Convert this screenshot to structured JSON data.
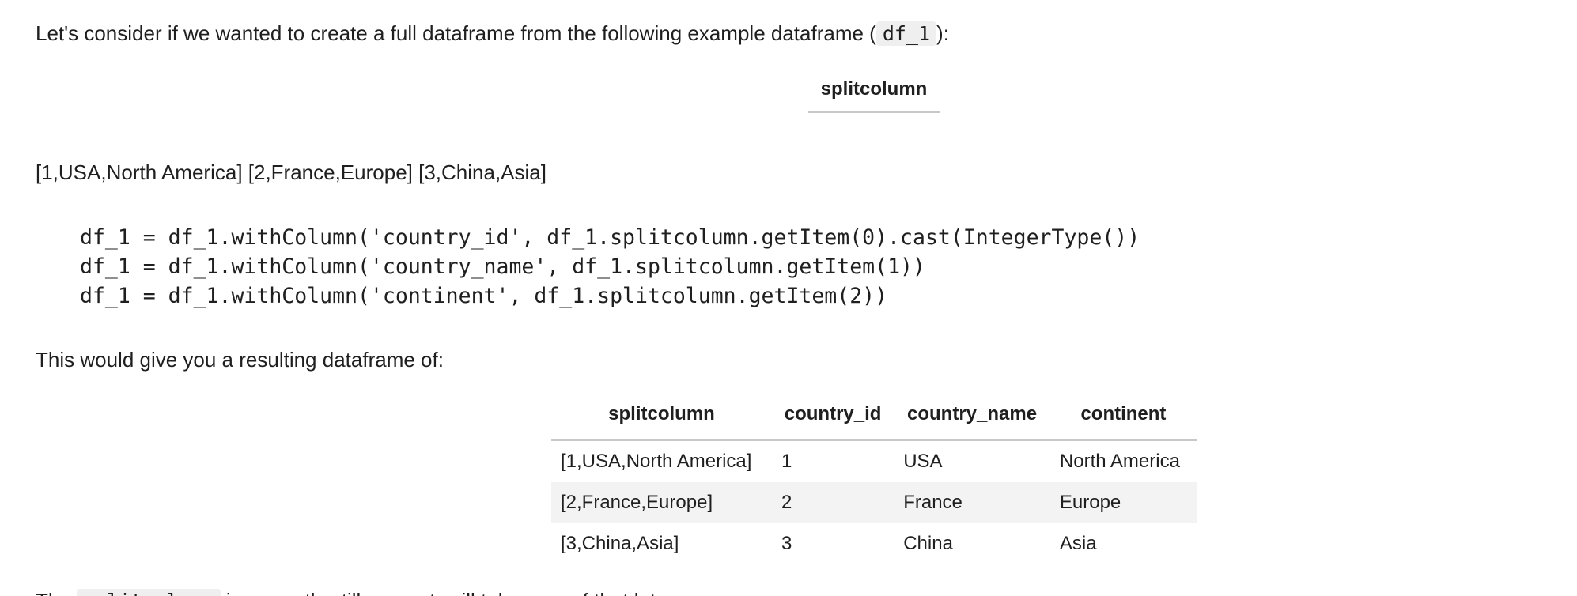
{
  "intro": {
    "before": "Let's consider if we wanted to create a full dataframe from the following example dataframe (",
    "code": "df_1",
    "after": "):"
  },
  "table1": {
    "header": "splitcolumn"
  },
  "list_line": "[1,USA,North America] [2,France,Europe] [3,China,Asia]",
  "code_block": [
    "df_1 = df_1.withColumn('country_id', df_1.splitcolumn.getItem(0).cast(IntegerType())",
    "df_1 = df_1.withColumn('country_name', df_1.splitcolumn.getItem(1))",
    "df_1 = df_1.withColumn('continent', df_1.splitcolumn.getItem(2))"
  ],
  "result_intro": "This would give you a resulting dataframe of:",
  "result_table": {
    "headers": [
      "splitcolumn",
      "country_id",
      "country_name",
      "continent"
    ],
    "rows": [
      [
        "[1,USA,North America]",
        "1",
        "USA",
        "North America"
      ],
      [
        "[2,France,Europe]",
        "2",
        "France",
        "Europe"
      ],
      [
        "[3,China,Asia]",
        "3",
        "China",
        "Asia"
      ]
    ]
  },
  "trailing": {
    "before": "The",
    "code": "splitcolumn",
    "after": "is currently still present, will take care of that later."
  }
}
